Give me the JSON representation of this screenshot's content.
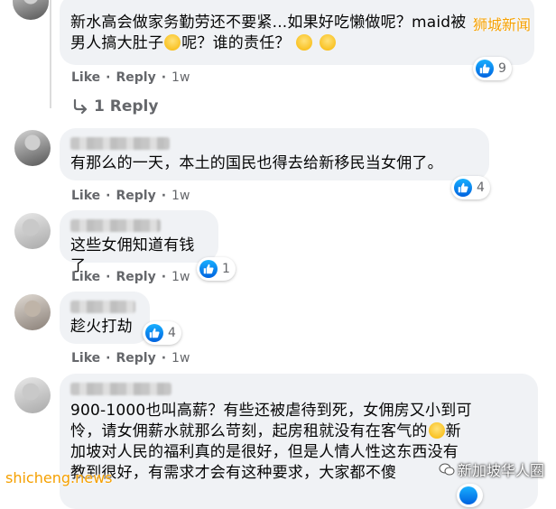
{
  "comments": [
    {
      "text_line1": "新水高会做家务勤劳还不要紧...如果好吃懒做呢？maid被",
      "text_line2": "男人搞大肚子",
      "text_line2b": "呢？谁的责任？",
      "reactions": "9",
      "like": "Like",
      "reply": "Reply",
      "time": "1w",
      "replies_link": "1 Reply"
    },
    {
      "text": "有那么的一天，本土的国民也得去给新移民当女佣了。",
      "reactions": "4",
      "like": "Like",
      "reply": "Reply",
      "time": "1w"
    },
    {
      "text": "这些女佣知道有钱了",
      "reactions": "1",
      "like": "Like",
      "reply": "Reply",
      "time": "1w"
    },
    {
      "text": "趁火打劫",
      "reactions": "4",
      "like": "Like",
      "reply": "Reply",
      "time": "1w"
    },
    {
      "text_line1": "900-1000也叫高薪？有些还被虐待到死，女佣房又小到可",
      "text_line2": "怜，请女佣薪水就那么苛刻，起房租就没有在客气的",
      "text_line2b": "新",
      "text_line3": "加坡对人民的福利真的是很好，但是人情人性这东西没有",
      "text_line4": "教到很好，有需求才会有这种要求，大家都不傻"
    }
  ],
  "watermarks": {
    "top_right": "狮城新闻",
    "bottom_left": "shicheng.news",
    "bottom_right": "新加坡华人圈"
  },
  "colors": {
    "bubble": "#f0f2f5",
    "meta": "#65676b",
    "like_blue": "#1877f2",
    "watermark": "#f5a000"
  }
}
